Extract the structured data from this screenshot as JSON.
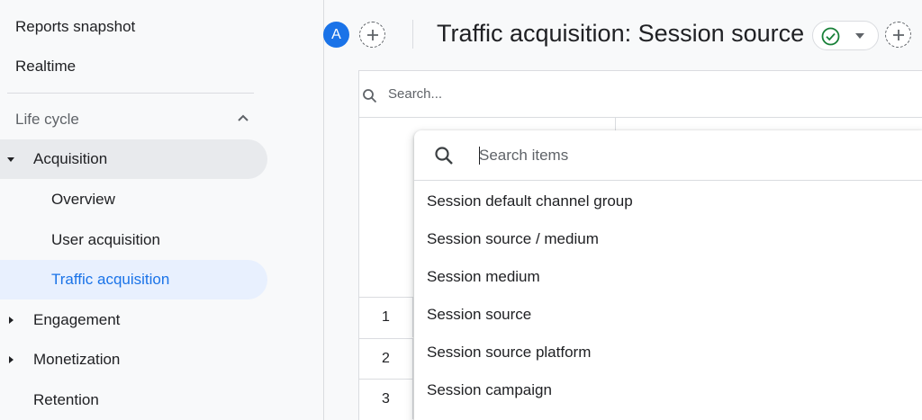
{
  "sidebar": {
    "reports_snapshot": "Reports snapshot",
    "realtime": "Realtime",
    "lifecycle": "Life cycle",
    "acquisition": {
      "label": "Acquisition",
      "children": [
        "Overview",
        "User acquisition",
        "Traffic acquisition"
      ]
    },
    "engagement": "Engagement",
    "monetization": "Monetization",
    "retention": "Retention"
  },
  "header": {
    "avatar_letter": "A",
    "title": "Traffic acquisition: Session source"
  },
  "table": {
    "search_placeholder": "Search...",
    "row_numbers": [
      "1",
      "2",
      "3"
    ]
  },
  "dropdown": {
    "search_placeholder": "Search items",
    "options": [
      "Session default channel group",
      "Session source / medium",
      "Session medium",
      "Session source",
      "Session source platform",
      "Session campaign"
    ]
  },
  "colors": {
    "accent": "#1a73e8",
    "selected_bg": "#e8f0fe",
    "success": "#188038"
  }
}
